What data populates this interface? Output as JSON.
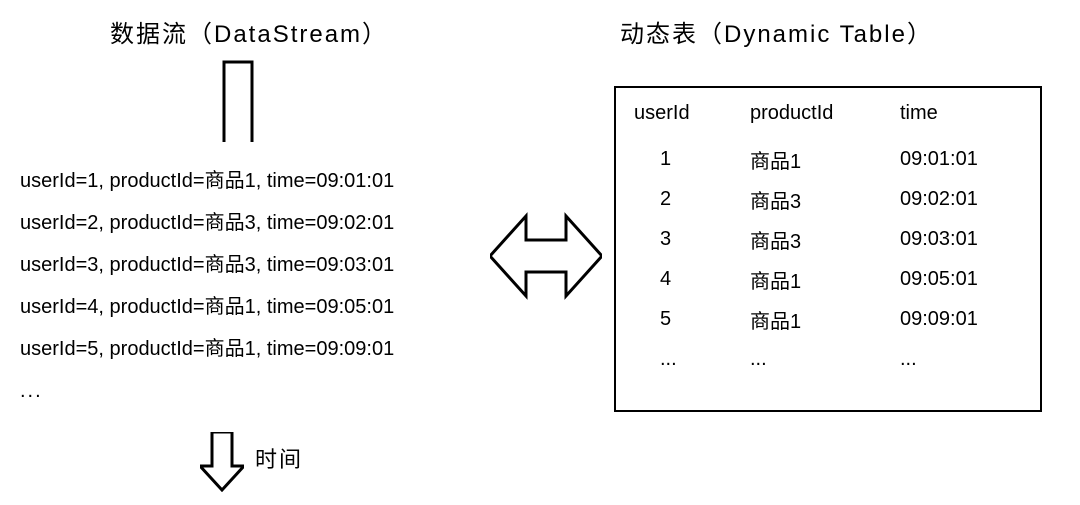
{
  "titles": {
    "left": "数据流（DataStream）",
    "right": "动态表（Dynamic Table）"
  },
  "time_label": "时间",
  "stream_key_labels": {
    "userId": "userId",
    "productId": "productId",
    "time": "time"
  },
  "stream_rows": [
    {
      "userId": "1",
      "productId": "商品1",
      "time": "09:01:01"
    },
    {
      "userId": "2",
      "productId": "商品3",
      "time": "09:02:01"
    },
    {
      "userId": "3",
      "productId": "商品3",
      "time": "09:03:01"
    },
    {
      "userId": "4",
      "productId": "商品1",
      "time": "09:05:01"
    },
    {
      "userId": "5",
      "productId": "商品1",
      "time": "09:09:01"
    }
  ],
  "stream_ellipsis": "...",
  "table": {
    "headers": {
      "userId": "userId",
      "productId": "productId",
      "time": "time"
    },
    "rows": [
      {
        "userId": "1",
        "productId": "商品1",
        "time": "09:01:01"
      },
      {
        "userId": "2",
        "productId": "商品3",
        "time": "09:02:01"
      },
      {
        "userId": "3",
        "productId": "商品3",
        "time": "09:03:01"
      },
      {
        "userId": "4",
        "productId": "商品1",
        "time": "09:05:01"
      },
      {
        "userId": "5",
        "productId": "商品1",
        "time": "09:09:01"
      }
    ],
    "ellipsis": "..."
  }
}
